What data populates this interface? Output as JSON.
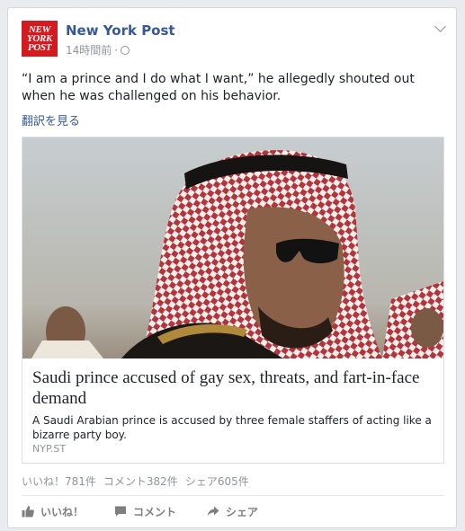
{
  "post": {
    "page_name": "New York Post",
    "logo_lines": [
      "NEW",
      "YORK",
      "POST"
    ],
    "timestamp": "14時間前",
    "separator": "·",
    "privacy_icon": "globe-icon",
    "menu_icon": "chevron-down-icon",
    "text": "“I am a prince and I do what I want,” he allegedly shouted out when he was challenged on his behavior.",
    "translate_label": "翻訳を見る"
  },
  "link": {
    "title": "Saudi prince accused of gay sex, threats, and fart-in-face demand",
    "description": "A Saudi Arabian prince is accused by three female staffers of acting like a bizarre party boy.",
    "domain": "NYP.ST"
  },
  "stats": {
    "likes": "いいね！781件",
    "comments": "コメント382件",
    "shares": "シェア605件"
  },
  "actions": {
    "like_label": "いいね！",
    "comment_label": "コメント",
    "share_label": "シェア"
  },
  "colors": {
    "brand_red": "#d51a1f",
    "link_blue": "#365899",
    "muted": "#90949c"
  }
}
